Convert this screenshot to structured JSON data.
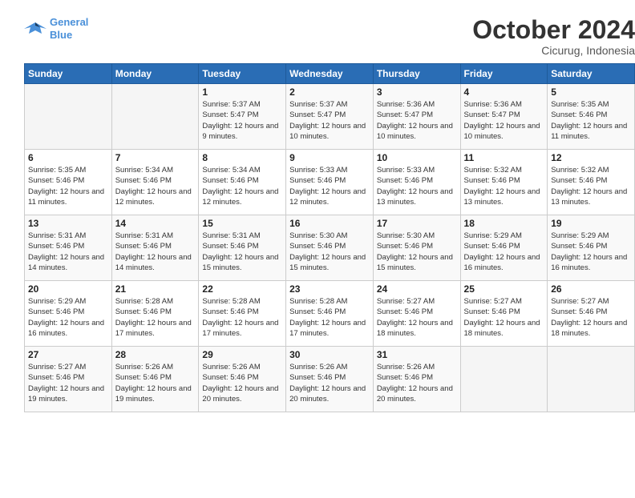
{
  "header": {
    "logo_line1": "General",
    "logo_line2": "Blue",
    "month": "October 2024",
    "location": "Cicurug, Indonesia"
  },
  "weekdays": [
    "Sunday",
    "Monday",
    "Tuesday",
    "Wednesday",
    "Thursday",
    "Friday",
    "Saturday"
  ],
  "weeks": [
    [
      {
        "day": "",
        "sunrise": "",
        "sunset": "",
        "daylight": ""
      },
      {
        "day": "",
        "sunrise": "",
        "sunset": "",
        "daylight": ""
      },
      {
        "day": "1",
        "sunrise": "Sunrise: 5:37 AM",
        "sunset": "Sunset: 5:47 PM",
        "daylight": "Daylight: 12 hours and 9 minutes."
      },
      {
        "day": "2",
        "sunrise": "Sunrise: 5:37 AM",
        "sunset": "Sunset: 5:47 PM",
        "daylight": "Daylight: 12 hours and 10 minutes."
      },
      {
        "day": "3",
        "sunrise": "Sunrise: 5:36 AM",
        "sunset": "Sunset: 5:47 PM",
        "daylight": "Daylight: 12 hours and 10 minutes."
      },
      {
        "day": "4",
        "sunrise": "Sunrise: 5:36 AM",
        "sunset": "Sunset: 5:47 PM",
        "daylight": "Daylight: 12 hours and 10 minutes."
      },
      {
        "day": "5",
        "sunrise": "Sunrise: 5:35 AM",
        "sunset": "Sunset: 5:46 PM",
        "daylight": "Daylight: 12 hours and 11 minutes."
      }
    ],
    [
      {
        "day": "6",
        "sunrise": "Sunrise: 5:35 AM",
        "sunset": "Sunset: 5:46 PM",
        "daylight": "Daylight: 12 hours and 11 minutes."
      },
      {
        "day": "7",
        "sunrise": "Sunrise: 5:34 AM",
        "sunset": "Sunset: 5:46 PM",
        "daylight": "Daylight: 12 hours and 12 minutes."
      },
      {
        "day": "8",
        "sunrise": "Sunrise: 5:34 AM",
        "sunset": "Sunset: 5:46 PM",
        "daylight": "Daylight: 12 hours and 12 minutes."
      },
      {
        "day": "9",
        "sunrise": "Sunrise: 5:33 AM",
        "sunset": "Sunset: 5:46 PM",
        "daylight": "Daylight: 12 hours and 12 minutes."
      },
      {
        "day": "10",
        "sunrise": "Sunrise: 5:33 AM",
        "sunset": "Sunset: 5:46 PM",
        "daylight": "Daylight: 12 hours and 13 minutes."
      },
      {
        "day": "11",
        "sunrise": "Sunrise: 5:32 AM",
        "sunset": "Sunset: 5:46 PM",
        "daylight": "Daylight: 12 hours and 13 minutes."
      },
      {
        "day": "12",
        "sunrise": "Sunrise: 5:32 AM",
        "sunset": "Sunset: 5:46 PM",
        "daylight": "Daylight: 12 hours and 13 minutes."
      }
    ],
    [
      {
        "day": "13",
        "sunrise": "Sunrise: 5:31 AM",
        "sunset": "Sunset: 5:46 PM",
        "daylight": "Daylight: 12 hours and 14 minutes."
      },
      {
        "day": "14",
        "sunrise": "Sunrise: 5:31 AM",
        "sunset": "Sunset: 5:46 PM",
        "daylight": "Daylight: 12 hours and 14 minutes."
      },
      {
        "day": "15",
        "sunrise": "Sunrise: 5:31 AM",
        "sunset": "Sunset: 5:46 PM",
        "daylight": "Daylight: 12 hours and 15 minutes."
      },
      {
        "day": "16",
        "sunrise": "Sunrise: 5:30 AM",
        "sunset": "Sunset: 5:46 PM",
        "daylight": "Daylight: 12 hours and 15 minutes."
      },
      {
        "day": "17",
        "sunrise": "Sunrise: 5:30 AM",
        "sunset": "Sunset: 5:46 PM",
        "daylight": "Daylight: 12 hours and 15 minutes."
      },
      {
        "day": "18",
        "sunrise": "Sunrise: 5:29 AM",
        "sunset": "Sunset: 5:46 PM",
        "daylight": "Daylight: 12 hours and 16 minutes."
      },
      {
        "day": "19",
        "sunrise": "Sunrise: 5:29 AM",
        "sunset": "Sunset: 5:46 PM",
        "daylight": "Daylight: 12 hours and 16 minutes."
      }
    ],
    [
      {
        "day": "20",
        "sunrise": "Sunrise: 5:29 AM",
        "sunset": "Sunset: 5:46 PM",
        "daylight": "Daylight: 12 hours and 16 minutes."
      },
      {
        "day": "21",
        "sunrise": "Sunrise: 5:28 AM",
        "sunset": "Sunset: 5:46 PM",
        "daylight": "Daylight: 12 hours and 17 minutes."
      },
      {
        "day": "22",
        "sunrise": "Sunrise: 5:28 AM",
        "sunset": "Sunset: 5:46 PM",
        "daylight": "Daylight: 12 hours and 17 minutes."
      },
      {
        "day": "23",
        "sunrise": "Sunrise: 5:28 AM",
        "sunset": "Sunset: 5:46 PM",
        "daylight": "Daylight: 12 hours and 17 minutes."
      },
      {
        "day": "24",
        "sunrise": "Sunrise: 5:27 AM",
        "sunset": "Sunset: 5:46 PM",
        "daylight": "Daylight: 12 hours and 18 minutes."
      },
      {
        "day": "25",
        "sunrise": "Sunrise: 5:27 AM",
        "sunset": "Sunset: 5:46 PM",
        "daylight": "Daylight: 12 hours and 18 minutes."
      },
      {
        "day": "26",
        "sunrise": "Sunrise: 5:27 AM",
        "sunset": "Sunset: 5:46 PM",
        "daylight": "Daylight: 12 hours and 18 minutes."
      }
    ],
    [
      {
        "day": "27",
        "sunrise": "Sunrise: 5:27 AM",
        "sunset": "Sunset: 5:46 PM",
        "daylight": "Daylight: 12 hours and 19 minutes."
      },
      {
        "day": "28",
        "sunrise": "Sunrise: 5:26 AM",
        "sunset": "Sunset: 5:46 PM",
        "daylight": "Daylight: 12 hours and 19 minutes."
      },
      {
        "day": "29",
        "sunrise": "Sunrise: 5:26 AM",
        "sunset": "Sunset: 5:46 PM",
        "daylight": "Daylight: 12 hours and 20 minutes."
      },
      {
        "day": "30",
        "sunrise": "Sunrise: 5:26 AM",
        "sunset": "Sunset: 5:46 PM",
        "daylight": "Daylight: 12 hours and 20 minutes."
      },
      {
        "day": "31",
        "sunrise": "Sunrise: 5:26 AM",
        "sunset": "Sunset: 5:46 PM",
        "daylight": "Daylight: 12 hours and 20 minutes."
      },
      {
        "day": "",
        "sunrise": "",
        "sunset": "",
        "daylight": ""
      },
      {
        "day": "",
        "sunrise": "",
        "sunset": "",
        "daylight": ""
      }
    ]
  ]
}
